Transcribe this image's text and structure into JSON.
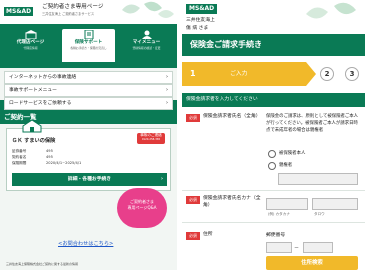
{
  "left": {
    "logo": "MS&AD",
    "title": "ご契約者さま専用ページ",
    "subtitle": "三井住友海上 ご契約者さまサービス",
    "nav": [
      {
        "label": "代理店ページ",
        "sub": "代理店情報"
      },
      {
        "label": "保険サポート",
        "sub": "各種お手続き・保険の見直し"
      },
      {
        "label": "マイメニュー",
        "sub": "登録情報の確認・変更"
      }
    ],
    "menu_items": [
      "インターネットからの事故連絡",
      "事故サポートメニュー",
      "ロードサービスをご依頼する"
    ],
    "section_title": "ご契約一覧",
    "card": {
      "title": "ＧＫ すまいの保険",
      "badge_line1": "事故のご連絡",
      "badge_line2": "0120-258-365",
      "rows": [
        {
          "key": "証券番号",
          "value": "495"
        },
        {
          "key": "契約者名",
          "value": "495"
        },
        {
          "key": "保険期間",
          "value": "2020/4/1~2025/4/1"
        }
      ],
      "button": "詳細・各種お手続き"
    },
    "bubble": {
      "line1": "ご契約者さま",
      "line2": "専用ページQ&A"
    },
    "contact_link": "<お問合わせはこちら>",
    "footer": "三井住友海上保険株式会社ご契約に関する最新の情報"
  },
  "right": {
    "logo": "MS&AD",
    "company": "三井住友海上",
    "user": "傷 病 さま",
    "page_title": "保険金ご請求手続き",
    "steps": [
      {
        "num": "1",
        "label": "ご入力"
      },
      {
        "num": "2"
      },
      {
        "num": "3"
      }
    ],
    "section": "保険金請求者を入力してください",
    "required_label": "必須",
    "field1": {
      "label": "保険金請求者氏名（全角）",
      "note": "保険金のご請求は、原則として被保険者ご本人が行ってください。被保険者ご本人が請求日時点で未成年者の場合は親権者",
      "options": [
        "被保険者本人",
        "親権者"
      ]
    },
    "field2": {
      "label": "保険金請求者氏名カナ（全角）",
      "hint_sei": "(例) カタカナ",
      "hint_mei": "タロウ"
    },
    "field3": {
      "label": "住所",
      "zip_label": "郵便番号",
      "button": "住所検索"
    }
  }
}
